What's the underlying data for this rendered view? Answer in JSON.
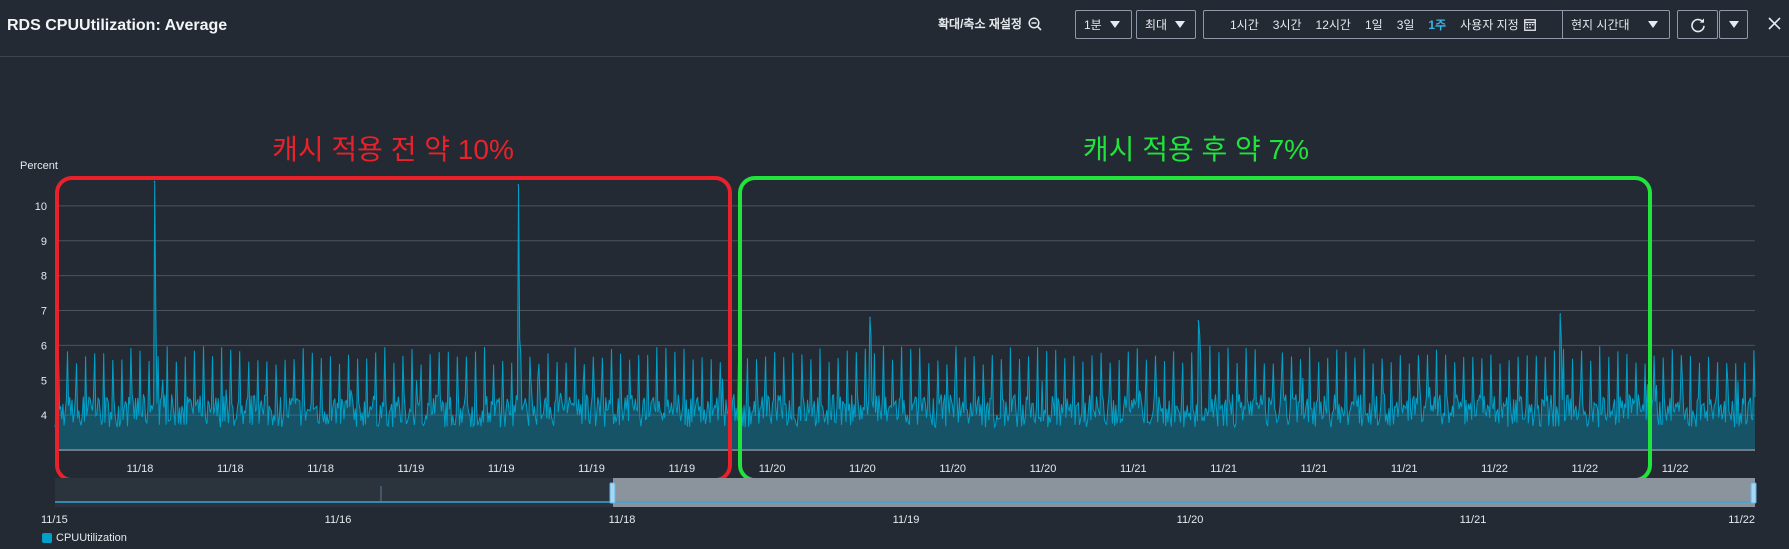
{
  "header": {
    "title": "RDS CPUUtilization: Average",
    "zoom_reset_label": "확대/축소 재설정",
    "period_select": "1분",
    "stat_select": "최대",
    "ranges": [
      "1시간",
      "3시간",
      "12시간",
      "1일",
      "3일",
      "1주"
    ],
    "active_range": "1주",
    "custom_label": "사용자 지정",
    "timezone_select": "현지 시간대"
  },
  "annotations": {
    "before": "캐시 적용 전 약 10%",
    "after": "캐시 적용 후 약 7%",
    "before_color": "#e8212b",
    "after_color": "#20e33c"
  },
  "chart_data": {
    "type": "line",
    "ylabel": "Percent",
    "y_ticks": [
      "4",
      "5",
      "6",
      "7",
      "8",
      "9",
      "10"
    ],
    "ylim": [
      3,
      10.8
    ],
    "x_ticks": [
      "11/18",
      "11/18",
      "11/18",
      "11/19",
      "11/19",
      "11/19",
      "11/19",
      "11/20",
      "11/20",
      "11/20",
      "11/20",
      "11/21",
      "11/21",
      "11/21",
      "11/21",
      "11/22",
      "11/22",
      "11/22"
    ],
    "series": [
      {
        "name": "CPUUtilization",
        "color": "#00a1c9",
        "baseline_approx": 3.9,
        "periodic_peak_approx": 5.8,
        "spikes": [
          {
            "x_label": "11/18",
            "value": 10.7
          },
          {
            "x_label": "11/19",
            "value": 10.6
          },
          {
            "x_label": "11/20",
            "value": 6.8
          },
          {
            "x_label": "11/21",
            "value": 6.7
          },
          {
            "x_label": "11/22",
            "value": 6.9
          }
        ]
      }
    ],
    "grid": true,
    "legend_position": "bottom-left"
  },
  "navigator": {
    "ticks": [
      "11/15",
      "11/16",
      "11/18",
      "11/19",
      "11/20",
      "11/21",
      "11/22"
    ]
  },
  "legend": {
    "label": "CPUUtilization"
  }
}
